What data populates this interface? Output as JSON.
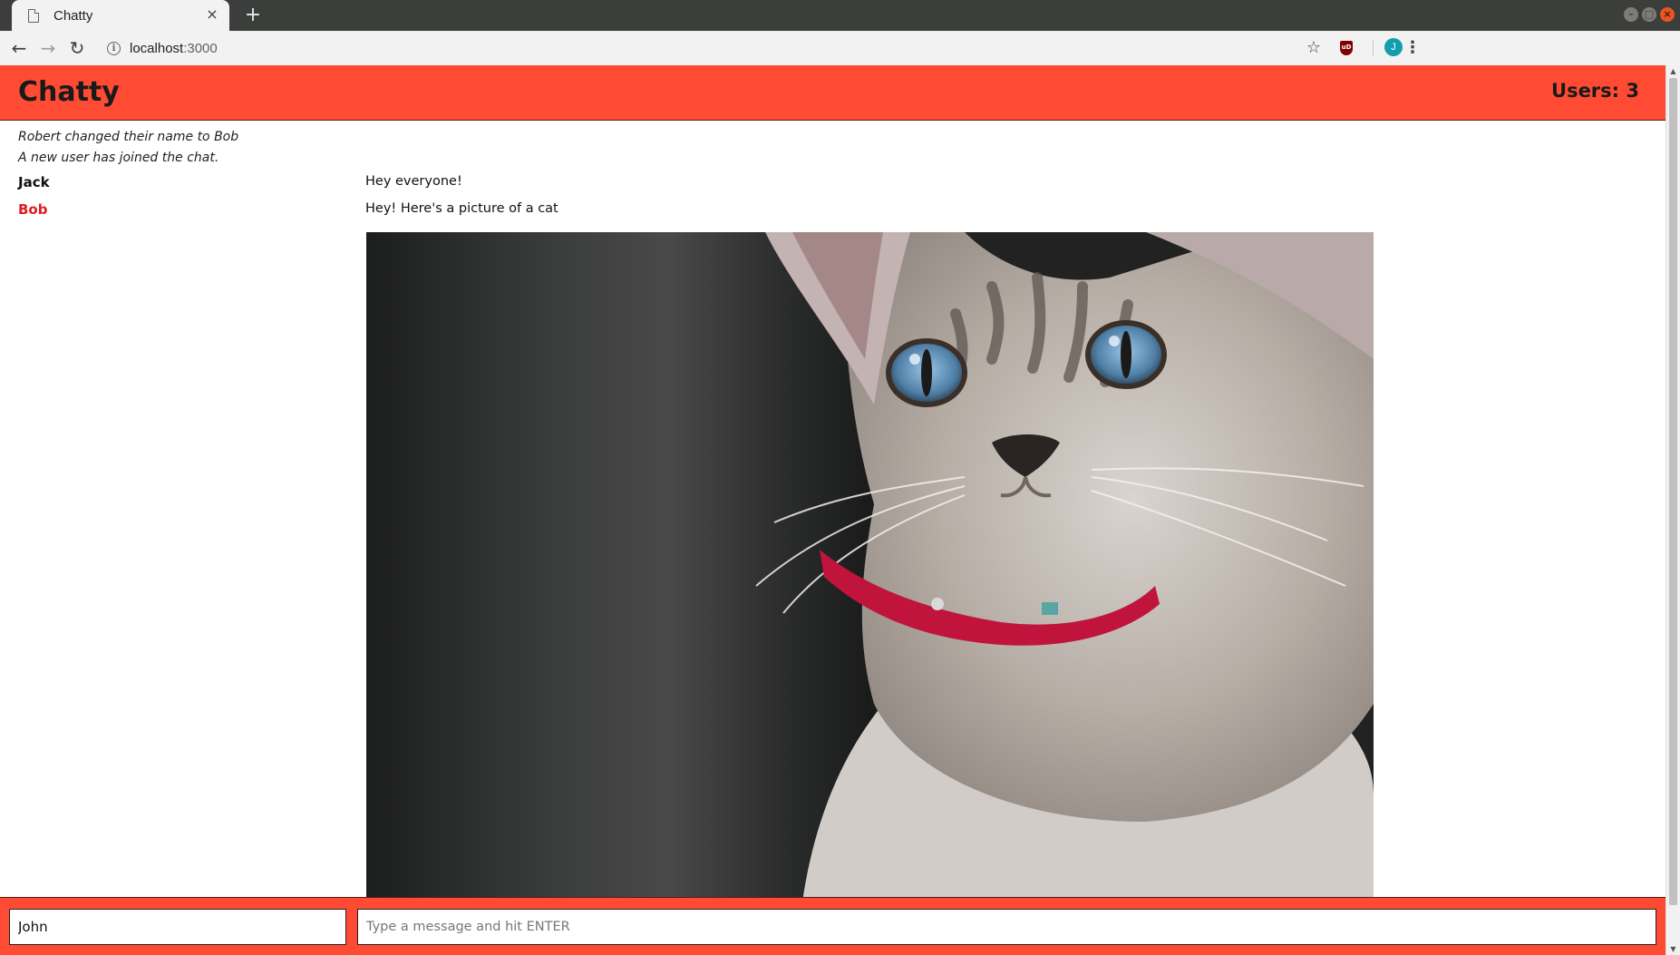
{
  "browser": {
    "tab_title": "Chatty",
    "tab_close": "×",
    "new_tab": "+",
    "url_host": "localhost",
    "url_port": ":3000",
    "profile_initial": "J",
    "ext_label": "uD"
  },
  "app": {
    "brand": "Chatty",
    "user_count": "Users: 3"
  },
  "messages": {
    "system": [
      "Robert changed their name to Bob",
      "A new user has joined the chat."
    ],
    "chat": [
      {
        "username": "Jack",
        "content": "Hey everyone!",
        "color": "#111111"
      },
      {
        "username": "Bob",
        "content": "Hey! Here's a picture of a cat",
        "color": "#e31b23"
      }
    ]
  },
  "chatbar": {
    "username_value": "John",
    "message_placeholder": "Type a message and hit ENTER"
  },
  "colors": {
    "accent": "#ff4b33",
    "bob_name": "#e31b23"
  }
}
